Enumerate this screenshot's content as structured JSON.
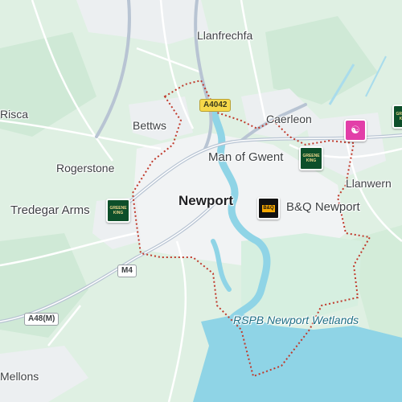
{
  "map": {
    "colors": {
      "land": "#dff0e3",
      "urban": "#f1f3f4",
      "water": "#8fd4e6",
      "wetland": "#d6efe0",
      "road": "#ffffff",
      "major_road": "#b8c4d3",
      "boundary": "#c0392b"
    },
    "places": {
      "llanfrechfa": "Llanfrechfa",
      "risca": "Risca",
      "bettws": "Bettws",
      "caerleon": "Caerleon",
      "rogerstone": "Rogerstone",
      "llanwern": "Llanwern",
      "newport": "Newport",
      "mellons": "Mellons"
    },
    "pois": {
      "man_of_gwent": "Man of Gwent",
      "tredegar_arms": "Tredegar Arms",
      "bq_newport": "B&Q Newport",
      "wetlands": "RSPB Newport Wetlands"
    },
    "roads": {
      "a4042": "A4042",
      "m4": "M4",
      "a48m": "A48(M)"
    },
    "icons": {
      "pub": "pub-icon",
      "store": "store-icon",
      "hotel": "hotel-icon"
    }
  }
}
